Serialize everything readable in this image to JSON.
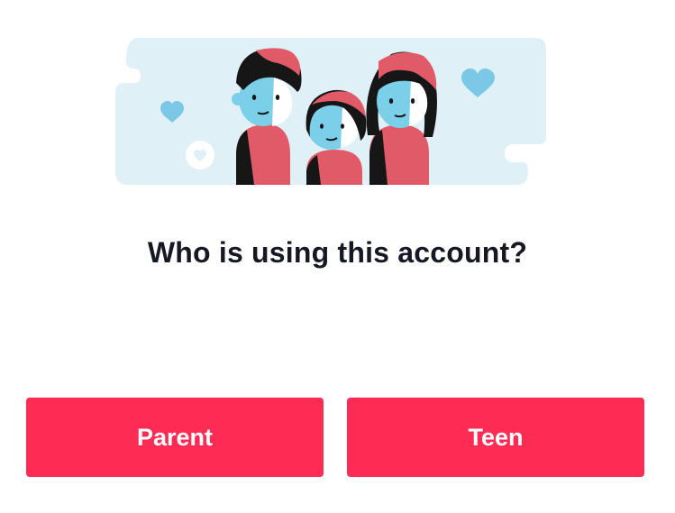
{
  "prompt": {
    "question": "Who is using this account?"
  },
  "buttons": {
    "parent_label": "Parent",
    "teen_label": "Teen"
  },
  "illustration": {
    "subject": "family-illustration",
    "icons": [
      "heart-icon",
      "heart-icon",
      "heart-badge-icon"
    ]
  },
  "colors": {
    "accent": "#fe2c55",
    "cloud": "#dff1f7",
    "heart": "#7ac8e6",
    "text": "#161823"
  }
}
